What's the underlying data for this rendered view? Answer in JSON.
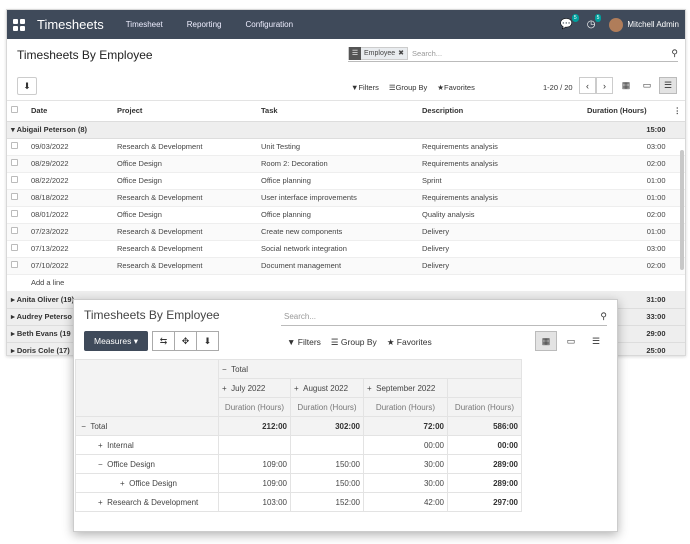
{
  "app": {
    "brand": "Timesheets",
    "menu": [
      "Timesheet",
      "Reporting",
      "Configuration"
    ],
    "messages_badge": "5",
    "activity_badge": "5",
    "user": "Mitchell Admin"
  },
  "list_view": {
    "title": "Timesheets By Employee",
    "facet": "Employee",
    "search_placeholder": "Search...",
    "filters": "Filters",
    "group_by": "Group By",
    "favorites": "Favorites",
    "pager": "1-20 / 20",
    "columns": [
      "Date",
      "Project",
      "Task",
      "Description",
      "Duration (Hours)"
    ],
    "groups": [
      {
        "label": "Abigail Peterson (8)",
        "total": "15:00",
        "expanded": true
      },
      {
        "label": "Anita Oliver (19)",
        "total": "31:00"
      },
      {
        "label": "Audrey Peterso",
        "total": "33:00"
      },
      {
        "label": "Beth Evans (19",
        "total": "29:00"
      },
      {
        "label": "Doris Cole (17)",
        "total": "25:00"
      }
    ],
    "rows": [
      [
        "09/03/2022",
        "Research & Development",
        "Unit Testing",
        "Requirements analysis",
        "03:00"
      ],
      [
        "08/29/2022",
        "Office Design",
        "Room 2: Decoration",
        "Requirements analysis",
        "02:00"
      ],
      [
        "08/22/2022",
        "Office Design",
        "Office planning",
        "Sprint",
        "01:00"
      ],
      [
        "08/18/2022",
        "Research & Development",
        "User interface improvements",
        "Requirements analysis",
        "01:00"
      ],
      [
        "08/01/2022",
        "Office Design",
        "Office planning",
        "Quality analysis",
        "02:00"
      ],
      [
        "07/23/2022",
        "Research & Development",
        "Create new components",
        "Delivery",
        "01:00"
      ],
      [
        "07/13/2022",
        "Research & Development",
        "Social network integration",
        "Delivery",
        "03:00"
      ],
      [
        "07/10/2022",
        "Research & Development",
        "Document management",
        "Delivery",
        "02:00"
      ]
    ],
    "add_line": "Add a line"
  },
  "pivot_view": {
    "title": "Timesheets By Employee",
    "search_placeholder": "Search...",
    "measures": "Measures",
    "filters": "Filters",
    "group_by": "Group By",
    "favorites": "Favorites",
    "col_total": "Total",
    "months": [
      "July 2022",
      "August 2022",
      "September 2022"
    ],
    "measure_label": "Duration (Hours)",
    "rows": [
      {
        "label": "Total",
        "sign": "−",
        "indent": 0,
        "values": [
          "212:00",
          "302:00",
          "72:00",
          "586:00"
        ],
        "bold": true
      },
      {
        "label": "Internal",
        "sign": "+",
        "indent": 1,
        "values": [
          "",
          "",
          "00:00",
          "00:00"
        ]
      },
      {
        "label": "Office Design",
        "sign": "−",
        "indent": 1,
        "values": [
          "109:00",
          "150:00",
          "30:00",
          "289:00"
        ]
      },
      {
        "label": "Office Design",
        "sign": "+",
        "indent": 2,
        "values": [
          "109:00",
          "150:00",
          "30:00",
          "289:00"
        ]
      },
      {
        "label": "Research & Development",
        "sign": "+",
        "indent": 1,
        "values": [
          "103:00",
          "152:00",
          "42:00",
          "297:00"
        ]
      }
    ]
  }
}
